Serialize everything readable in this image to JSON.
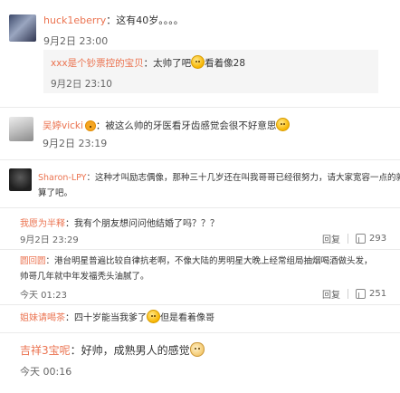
{
  "comments": [
    {
      "user": "huck1eberry",
      "text": "：这有40岁。。。。",
      "time": "9月2日 23:00",
      "reply": {
        "user": "xxx是个钞票控的宝贝",
        "text_before": "：太帅了吧",
        "text_after": "看着像28",
        "time": "9月2日 23:10"
      }
    },
    {
      "user": "吴婷vicki",
      "text": "：被这么帅的牙医看牙齿感觉会很不好意思",
      "time": "9月2日 23:19"
    },
    {
      "user": "Sharon-LPY",
      "text": "：这种才叫励志偶像，那种三十几岁还在叫我哥哥已经很努力，请大家宽容一点的就",
      "text_line2": "算了吧。"
    },
    {
      "user": "我愿为半释",
      "text": "：我有个朋友想问问他结婚了吗？？？",
      "time": "9月2日 23:29",
      "reply_label": "回复",
      "likes": "293"
    },
    {
      "user": "圆回圆",
      "text": "：港台明星普遍比较自律抗老啊，不像大陆的男明星大晚上经常组局抽烟喝酒做头发，",
      "text_line2": "帅哥几年就中年发福秃头油腻了。",
      "time": "今天 01:23",
      "reply_label": "回复",
      "likes": "251"
    },
    {
      "user": "姐妹请喝茶",
      "text_before": "：四十岁能当我爹了",
      "text_after": "但是看着像哥"
    },
    {
      "user": "吉祥3宝呢",
      "text": "：好帅，成熟男人的感觉",
      "time": "今天 00:16"
    }
  ]
}
